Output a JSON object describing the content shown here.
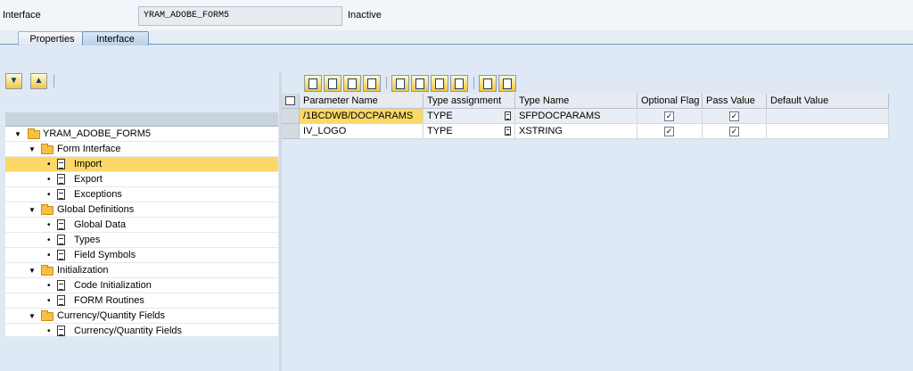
{
  "header": {
    "label": "Interface",
    "field_value": "YRAM_ADOBE_FORM5",
    "status": "Inactive"
  },
  "tabs": [
    {
      "label": "Properties",
      "active": false
    },
    {
      "label": "Interface",
      "active": true
    }
  ],
  "tree": {
    "nodes": [
      {
        "label": "YRAM_ADOBE_FORM5",
        "level": 0,
        "type": "folder"
      },
      {
        "label": "Form Interface",
        "level": 1,
        "type": "folder"
      },
      {
        "label": "Import",
        "level": 2,
        "type": "doc",
        "selected": true
      },
      {
        "label": "Export",
        "level": 2,
        "type": "doc"
      },
      {
        "label": "Exceptions",
        "level": 2,
        "type": "doc"
      },
      {
        "label": "Global Definitions",
        "level": 1,
        "type": "folder"
      },
      {
        "label": "Global Data",
        "level": 2,
        "type": "doc"
      },
      {
        "label": "Types",
        "level": 2,
        "type": "doc"
      },
      {
        "label": "Field Symbols",
        "level": 2,
        "type": "doc"
      },
      {
        "label": "Initialization",
        "level": 1,
        "type": "folder"
      },
      {
        "label": "Code Initialization",
        "level": 2,
        "type": "doc"
      },
      {
        "label": "FORM Routines",
        "level": 2,
        "type": "doc"
      },
      {
        "label": "Currency/Quantity Fields",
        "level": 1,
        "type": "folder"
      },
      {
        "label": "Currency/Quantity Fields",
        "level": 2,
        "type": "doc"
      }
    ]
  },
  "table": {
    "columns": [
      "Parameter Name",
      "Type assignment",
      "Type Name",
      "Optional Flag",
      "Pass Value",
      "Default Value"
    ],
    "rows": [
      {
        "param": "/1BCDWB/DOCPARAMS",
        "type_assignment": "TYPE",
        "type_name": "SFPDOCPARAMS",
        "optional": true,
        "pass_value": true,
        "default": ""
      },
      {
        "param": "IV_LOGO",
        "type_assignment": "TYPE",
        "type_name": "XSTRING",
        "optional": true,
        "pass_value": true,
        "default": ""
      }
    ]
  },
  "icons": {
    "expand_all": "expand-all-icon",
    "collapse_all": "collapse-all-icon",
    "toolbar": [
      "cut-icon",
      "copy-icon",
      "paste-icon",
      "undo-icon",
      "new-row-icon",
      "insert-row-icon",
      "delete-row-icon",
      "duplicate-row-icon",
      "find-icon",
      "find-next-icon"
    ]
  },
  "checkmark": "✓"
}
